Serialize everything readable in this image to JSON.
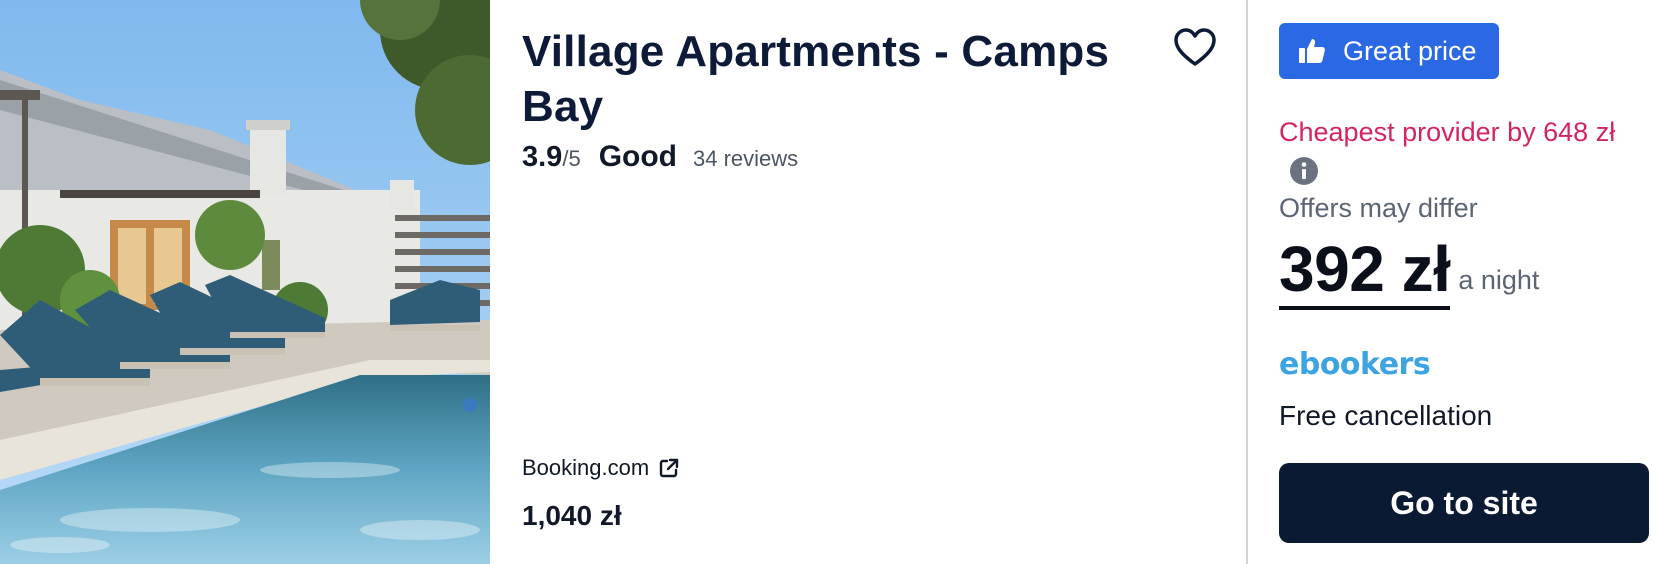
{
  "hotel": {
    "name": "Village Apartments - Camps Bay",
    "rating": {
      "score": "3.9",
      "max": "/5",
      "label": "Good",
      "reviews": "34 reviews"
    },
    "alternative": {
      "provider": "Booking.com",
      "price": "1,040 zł"
    }
  },
  "deal": {
    "badge": "Great price",
    "cheapest_text": "Cheapest provider by 648 zł",
    "offers_note": "Offers may differ",
    "price": "392 zł",
    "price_unit": "a night",
    "provider": "ebookers",
    "cancellation": "Free cancellation",
    "cta": "Go to site"
  },
  "colors": {
    "accent_blue": "#2a68e4",
    "navy": "#0b1a33",
    "pink": "#d32464",
    "ebookers_blue": "#3ea3e1"
  },
  "icons": {
    "favorite": "heart-outline-icon",
    "badge": "thumbs-up-icon",
    "info": "info-circle-icon",
    "external": "external-link-icon"
  }
}
